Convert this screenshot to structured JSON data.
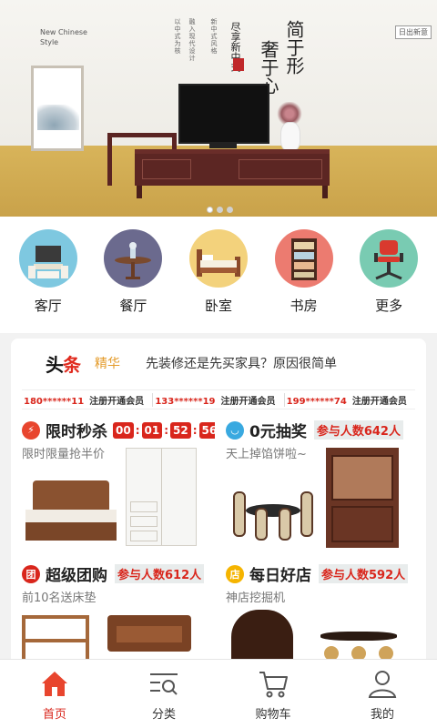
{
  "banner": {
    "english_text": "New Chinese\nStyle",
    "title_a": "简于形",
    "title_b": "奢于心",
    "title_c": "尽享新中式",
    "tag": "日出新意",
    "pages": 3,
    "active_page": 0
  },
  "categories": [
    {
      "label": "客厅",
      "icon": "sofa-tv-icon",
      "color": "#7ec8e0"
    },
    {
      "label": "餐厅",
      "icon": "dining-table-icon",
      "color": "#6b6a8e"
    },
    {
      "label": "卧室",
      "icon": "bed-icon",
      "color": "#f3d27c"
    },
    {
      "label": "书房",
      "icon": "bookshelf-icon",
      "color": "#ec7b70"
    },
    {
      "label": "更多",
      "icon": "chair-icon",
      "color": "#79cbb2"
    }
  ],
  "news": {
    "logo_part1": "头",
    "logo_part2": "条",
    "tag": "精华",
    "headline": "先装修还是先买家具？原因很简单"
  },
  "ticker": [
    {
      "phone": "180******11",
      "msg": "注册开通会员"
    },
    {
      "phone": "133******19",
      "msg": "注册开通会员"
    },
    {
      "phone": "199******74",
      "msg": "注册开通会员"
    }
  ],
  "cards": {
    "flash": {
      "icon_char": "⚡",
      "title": "限时秒杀",
      "subtitle": "限时限量抢半价",
      "countdown": [
        "00",
        "01",
        "52",
        "56"
      ],
      "color": "#e8452e"
    },
    "lottery": {
      "icon_char": "◡",
      "title": "0元抽奖",
      "badge": "参与人数642人",
      "subtitle": "天上掉馅饼啦~",
      "color": "#39a9e0"
    },
    "group": {
      "icon_char": "团",
      "title": "超级团购",
      "badge": "参与人数612人",
      "subtitle": "前10名送床垫",
      "color": "#d9261c"
    },
    "daily": {
      "icon_char": "店",
      "title": "每日好店",
      "badge": "参与人数592人",
      "subtitle": "神店挖掘机",
      "color": "#f5b400"
    }
  },
  "tabs": [
    {
      "label": "首页",
      "icon": "home-icon",
      "active": true
    },
    {
      "label": "分类",
      "icon": "category-search-icon",
      "active": false
    },
    {
      "label": "购物车",
      "icon": "cart-icon",
      "active": false
    },
    {
      "label": "我的",
      "icon": "user-icon",
      "active": false
    }
  ],
  "colors": {
    "accent": "#d9261c",
    "gold_floor": "#d8b45a"
  }
}
